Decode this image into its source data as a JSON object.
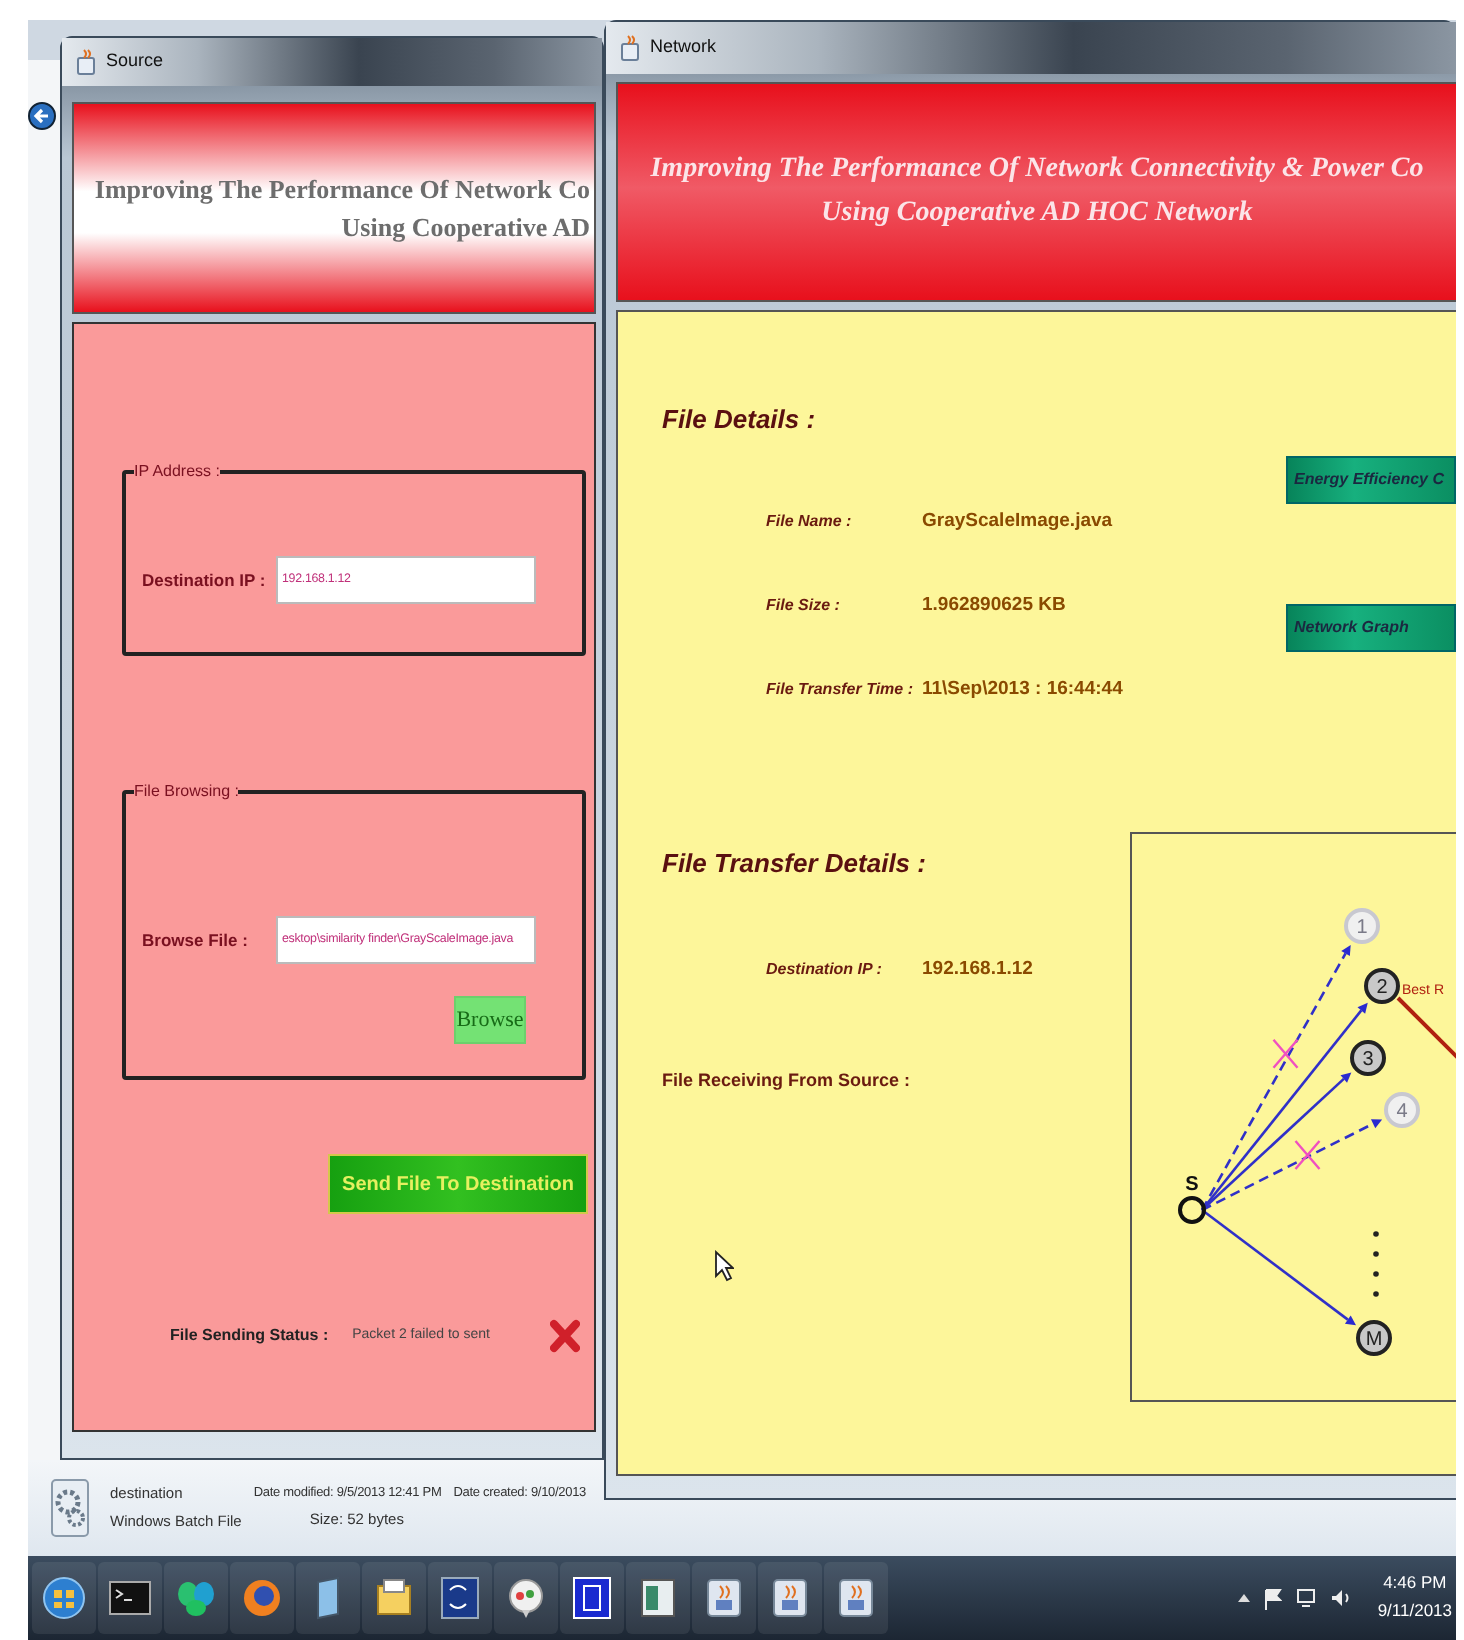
{
  "source_window": {
    "title": "Source",
    "header_lines": [
      "Improving The Performance Of Network Co",
      "Using Cooperative AD"
    ],
    "ip_group": {
      "legend": "IP Address :",
      "label": "Destination IP :",
      "value": "192.168.1.12"
    },
    "file_group": {
      "legend": "File Browsing :",
      "label": "Browse File :",
      "value": "esktop\\similarity finder\\GrayScaleImage.java",
      "browse_button": "Browse"
    },
    "send_button": "Send File To Destination",
    "status": {
      "label": "File Sending Status :",
      "value": "Packet 2 failed to sent",
      "failed": true
    }
  },
  "network_window": {
    "title": "Network",
    "header_lines": [
      "Improving The Performance Of Network Connectivity & Power Co",
      "Using Cooperative AD HOC Network"
    ],
    "file_details": {
      "heading": "File Details :",
      "rows": [
        {
          "label": "File Name :",
          "value": "GrayScaleImage.java"
        },
        {
          "label": "File Size :",
          "value": "1.962890625 KB"
        },
        {
          "label": "File Transfer Time :",
          "value": "11\\Sep\\2013 : 16:44:44"
        }
      ]
    },
    "buttons": [
      "Energy Efficiency C",
      "Network Graph"
    ],
    "transfer_details": {
      "heading": "File Transfer Details :",
      "rows": [
        {
          "label": "Destination IP :",
          "value": "192.168.1.12"
        }
      ]
    },
    "receiving_label": "File Receiving From Source :",
    "diagram": {
      "source_label": "S",
      "link_label": "Best R",
      "nodes": [
        {
          "label": "1",
          "reachable": false
        },
        {
          "label": "2",
          "reachable": true
        },
        {
          "label": "3",
          "reachable": true
        },
        {
          "label": "4",
          "reachable": false
        },
        {
          "label": "M",
          "reachable": true
        }
      ]
    }
  },
  "explorer_details": {
    "name": "destination",
    "type": "Windows Batch File",
    "modified": "Date modified: 9/5/2013 12:41 PM",
    "size": "Size: 52 bytes",
    "created": "Date created: 9/10/2013"
  },
  "taskbar": {
    "time": "4:46 PM",
    "date": "9/11/2013"
  }
}
